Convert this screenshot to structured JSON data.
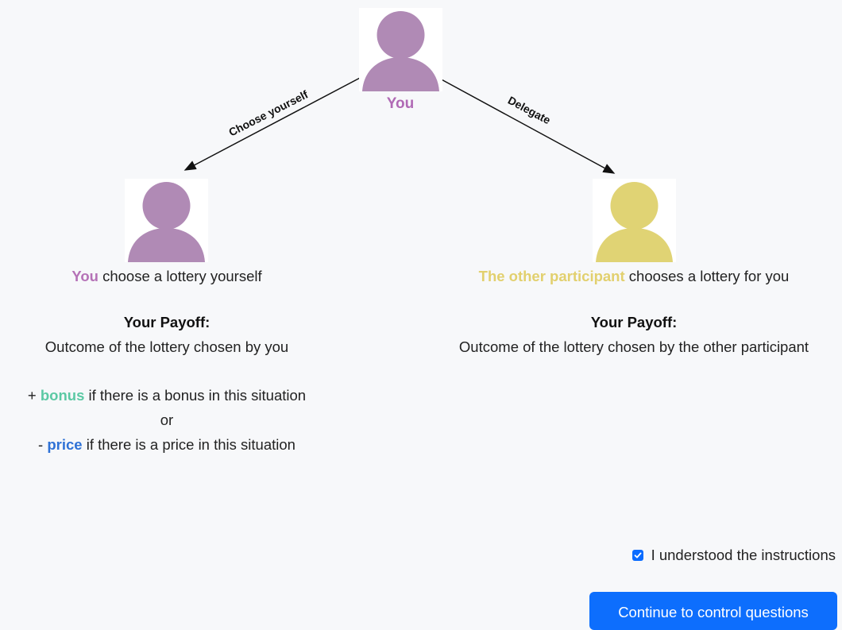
{
  "diagram": {
    "top_label": "You",
    "arrow_left_label": "Choose yourself",
    "arrow_right_label": "Delegate",
    "colors": {
      "you": "#b08ab5",
      "other": "#e0d374",
      "arrow": "#111111"
    },
    "icons": {
      "top": "person-icon",
      "left": "person-icon",
      "right": "person-icon"
    }
  },
  "left": {
    "headline_highlight": "You",
    "headline_rest": " choose a lottery yourself",
    "payoff_title": "Your Payoff:",
    "payoff_text": "Outcome of the lottery chosen by you",
    "bonus_prefix": "+ ",
    "bonus_word": "bonus",
    "bonus_rest": " if there is a bonus in this situation",
    "or_text": "or",
    "price_prefix": "- ",
    "price_word": "price",
    "price_rest": " if there is a price in this situation"
  },
  "right": {
    "headline_highlight": "The other participant",
    "headline_rest": " chooses a lottery for you",
    "payoff_title": "Your Payoff:",
    "payoff_text": "Outcome of the lottery chosen by the other participant"
  },
  "confirm": {
    "label": "I understood the instructions",
    "checked": true
  },
  "continue_button": {
    "label": "Continue to control questions"
  }
}
